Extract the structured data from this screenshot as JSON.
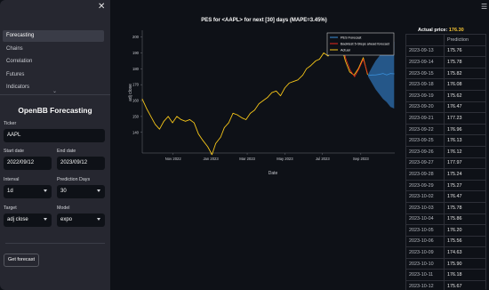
{
  "sidebar": {
    "nav_items": [
      {
        "label": "Forecasting",
        "active": true
      },
      {
        "label": "Chains",
        "active": false
      },
      {
        "label": "Correlation",
        "active": false
      },
      {
        "label": "Futures",
        "active": false
      },
      {
        "label": "Indicators",
        "active": false
      }
    ],
    "form_title": "OpenBB Forecasting",
    "ticker": {
      "label": "Ticker",
      "value": "AAPL"
    },
    "start_date": {
      "label": "Start date",
      "value": "2022/09/12"
    },
    "end_date": {
      "label": "End date",
      "value": "2023/09/12"
    },
    "interval": {
      "label": "Interval",
      "value": "1d"
    },
    "prediction_days": {
      "label": "Prediction Days",
      "value": "30"
    },
    "target": {
      "label": "Target",
      "value": "adj close"
    },
    "model": {
      "label": "Model",
      "value": "expo"
    },
    "submit_label": "Get forecast"
  },
  "chart": {
    "title": "PES for <AAPL> for next [30] days (MAPE=3.45%)",
    "ylabel": "adj close",
    "xlabel": "Date",
    "legend": [
      "PES Forecast",
      "Backtest 5-Steps ahead forecast",
      "Actual"
    ]
  },
  "chart_data": {
    "type": "line",
    "title": "PES for <AAPL> for next [30] days (MAPE=3.45%)",
    "xlabel": "Date",
    "ylabel": "adj close",
    "ylim": [
      127,
      202
    ],
    "y_ticks": [
      140,
      150,
      160,
      170,
      180,
      190,
      200
    ],
    "x_ticks": [
      "Nov 2022",
      "Jan 2023",
      "Mar 2023",
      "May 2023",
      "Jul 2023",
      "Sep 2023"
    ],
    "x_range": [
      "2022-09-12",
      "2023-10-26"
    ],
    "grid": false,
    "legend_position": "top-right",
    "colors": {
      "actual": "#f5c518",
      "backtest": "#e8291c",
      "forecast": "#3a8fd9",
      "band": "#2d6fb0"
    },
    "series": [
      {
        "name": "Actual",
        "x": [
          "2022-09-12",
          "2022-09-19",
          "2022-09-26",
          "2022-10-03",
          "2022-10-10",
          "2022-10-17",
          "2022-10-24",
          "2022-10-31",
          "2022-11-07",
          "2022-11-14",
          "2022-11-21",
          "2022-11-28",
          "2022-12-05",
          "2022-12-12",
          "2022-12-19",
          "2022-12-27",
          "2023-01-03",
          "2023-01-09",
          "2023-01-17",
          "2023-01-23",
          "2023-01-30",
          "2023-02-06",
          "2023-02-13",
          "2023-02-21",
          "2023-02-27",
          "2023-03-06",
          "2023-03-13",
          "2023-03-20",
          "2023-03-27",
          "2023-04-03",
          "2023-04-10",
          "2023-04-17",
          "2023-04-24",
          "2023-05-01",
          "2023-05-08",
          "2023-05-15",
          "2023-05-22",
          "2023-05-30",
          "2023-06-05",
          "2023-06-12",
          "2023-06-20",
          "2023-06-26",
          "2023-07-03",
          "2023-07-10",
          "2023-07-17",
          "2023-07-24",
          "2023-07-31",
          "2023-08-07",
          "2023-08-14",
          "2023-08-21",
          "2023-08-28",
          "2023-09-05",
          "2023-09-12"
        ],
        "y": [
          161,
          155,
          150,
          145,
          142,
          147,
          150,
          146,
          150,
          148,
          147,
          148,
          146,
          139,
          135,
          131,
          126,
          133,
          137,
          143,
          146,
          152,
          151,
          149,
          148,
          152,
          154,
          158,
          160,
          162,
          165,
          166,
          163,
          168,
          171,
          172,
          173,
          176,
          180,
          182,
          185,
          186,
          190,
          188,
          192,
          193,
          195,
          185,
          178,
          176,
          180,
          187,
          176.3
        ]
      },
      {
        "name": "Backtest 5-Steps ahead forecast",
        "x": [
          "2023-08-01",
          "2023-08-08",
          "2023-08-15",
          "2023-08-22",
          "2023-08-29",
          "2023-09-05",
          "2023-09-12"
        ],
        "y": [
          196,
          186,
          179,
          175,
          180,
          186,
          177
        ]
      },
      {
        "name": "PES Forecast",
        "x": [
          "2023-09-13",
          "2023-09-19",
          "2023-09-25",
          "2023-10-01",
          "2023-10-07",
          "2023-10-13",
          "2023-10-19",
          "2023-10-25"
        ],
        "y": [
          175.76,
          176.08,
          176.13,
          176.5,
          177.0,
          176.1,
          177.0,
          176.8
        ],
        "upper": [
          176.5,
          181,
          185,
          188,
          191,
          194,
          196,
          197
        ],
        "lower": [
          175,
          171,
          167,
          164,
          161,
          159,
          156,
          155
        ]
      }
    ]
  },
  "predictions": {
    "actual_price_label": "Actual price:",
    "actual_price_value": "176.30",
    "header": "Prediction",
    "rows": [
      {
        "date": "2023-09-13",
        "value": "175.76"
      },
      {
        "date": "2023-09-14",
        "value": "175.78"
      },
      {
        "date": "2023-09-15",
        "value": "175.82"
      },
      {
        "date": "2023-09-18",
        "value": "176.08"
      },
      {
        "date": "2023-09-19",
        "value": "175.62"
      },
      {
        "date": "2023-09-20",
        "value": "176.47"
      },
      {
        "date": "2023-09-21",
        "value": "177.23"
      },
      {
        "date": "2023-09-22",
        "value": "176.96"
      },
      {
        "date": "2023-09-25",
        "value": "176.13"
      },
      {
        "date": "2023-09-26",
        "value": "176.12"
      },
      {
        "date": "2023-09-27",
        "value": "177.97"
      },
      {
        "date": "2023-09-28",
        "value": "175.24"
      },
      {
        "date": "2023-09-29",
        "value": "175.27"
      },
      {
        "date": "2023-10-02",
        "value": "176.47"
      },
      {
        "date": "2023-10-03",
        "value": "175.78"
      },
      {
        "date": "2023-10-04",
        "value": "175.86"
      },
      {
        "date": "2023-10-05",
        "value": "176.20"
      },
      {
        "date": "2023-10-06",
        "value": "175.56"
      },
      {
        "date": "2023-10-09",
        "value": "174.63"
      },
      {
        "date": "2023-10-10",
        "value": "175.90"
      },
      {
        "date": "2023-10-11",
        "value": "176.18"
      },
      {
        "date": "2023-10-12",
        "value": "175.67"
      }
    ]
  },
  "icons": {
    "close": "close-icon",
    "menu": "hamburger-menu-icon",
    "nav_more": "chevron-down-icon"
  }
}
